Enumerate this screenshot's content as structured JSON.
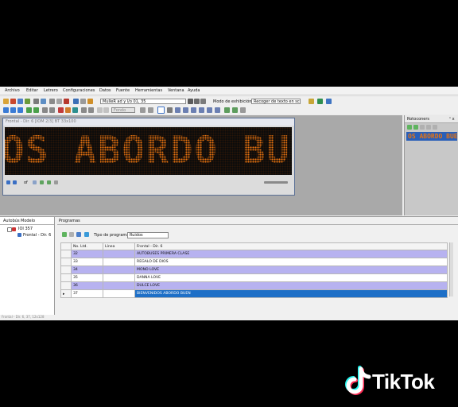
{
  "menu": [
    "Archivo",
    "Editar",
    "Letrero",
    "Configuraciones",
    "Datos",
    "Fuente",
    "Herramientas",
    "Ventana",
    "Ayuda"
  ],
  "toolbar": {
    "font_select": "MulleR ad y l/o 01, 35",
    "display_mode_label": "Modo de exhibición",
    "display_mode_value": "Recoger de texto en sc",
    "mode_select": "Fondo"
  },
  "led_window": {
    "title": "Frontal - Dir. 6 [IOM 2/3] BT 33x100",
    "display_text": "OS ABORDO BUEN",
    "led_color": "#e8730f",
    "nav_label": "of"
  },
  "side_panel": {
    "title": "Rotoconers",
    "pin": "ⁿ x",
    "item": "OS ABORDO BUEN"
  },
  "lower_left": {
    "tabs": [
      "Autobús",
      "Modelo"
    ],
    "tree_root": "IOI 357",
    "tree_child": "Frontal - Dir. 6"
  },
  "lower_main": {
    "tab": "Programas",
    "program_type_label": "Tipo de programa:",
    "program_type_value": "Ruidos",
    "headers": [
      "No. Ltd.",
      "Línea",
      "Frontal - Dir. 6"
    ],
    "rows": [
      {
        "num": "32",
        "line": "",
        "text": "AUTOBUSES PRIMERA CLASE"
      },
      {
        "num": "33",
        "line": "",
        "text": "REGALO DE DIOS"
      },
      {
        "num": "34",
        "line": "",
        "text": "MONO LOVE"
      },
      {
        "num": "35",
        "line": "",
        "text": "DANNA LOVE"
      },
      {
        "num": "36",
        "line": "",
        "text": "DULCE LOVE"
      },
      {
        "num": "37",
        "line": "",
        "text": "BIENVENIDOS ABORDO BUEN"
      }
    ]
  },
  "status_text": "Frontal - Dir. 6, 37, 12x128",
  "watermark": {
    "brand": "TikTok",
    "accent_cyan": "#25f4ee",
    "accent_red": "#fe2c55"
  }
}
